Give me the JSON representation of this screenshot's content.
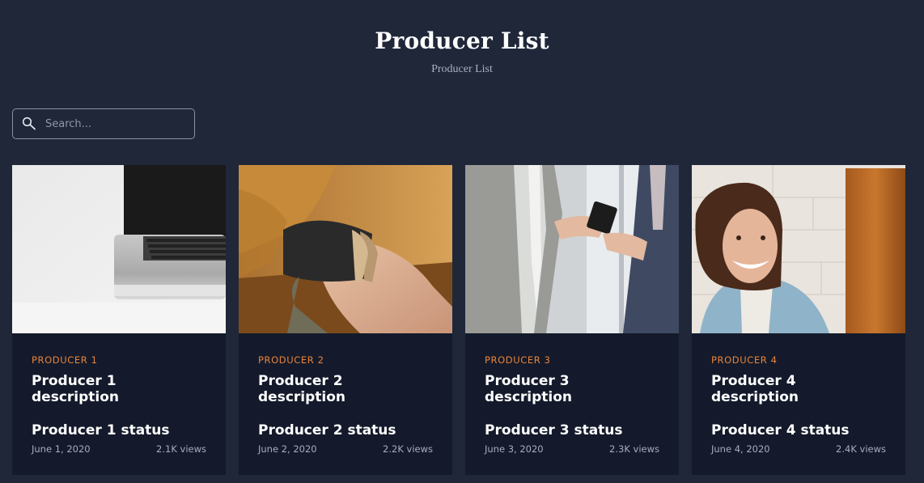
{
  "header": {
    "title": "Producer List",
    "subtitle": "Producer List"
  },
  "search": {
    "placeholder": "Search...",
    "value": "",
    "icon": "search-icon"
  },
  "accent_color": "#e8843a",
  "cards": [
    {
      "category": "PRODUCER 1",
      "description": "Producer 1 description",
      "status": "Producer 1 status",
      "date": "June 1, 2020",
      "views": "2.1K views",
      "image": "laptop-photo"
    },
    {
      "category": "PRODUCER 2",
      "description": "Producer 2 description",
      "status": "Producer 2 status",
      "date": "June 2, 2020",
      "views": "2.2K views",
      "image": "wrist-bracelets-photo"
    },
    {
      "category": "PRODUCER 3",
      "description": "Producer 3 description",
      "status": "Producer 3 status",
      "date": "June 3, 2020",
      "views": "2.3K views",
      "image": "businessmen-phone-photo"
    },
    {
      "category": "PRODUCER 4",
      "description": "Producer 4 description",
      "status": "Producer 4 status",
      "date": "June 4, 2020",
      "views": "2.4K views",
      "image": "smiling-woman-photo"
    }
  ]
}
